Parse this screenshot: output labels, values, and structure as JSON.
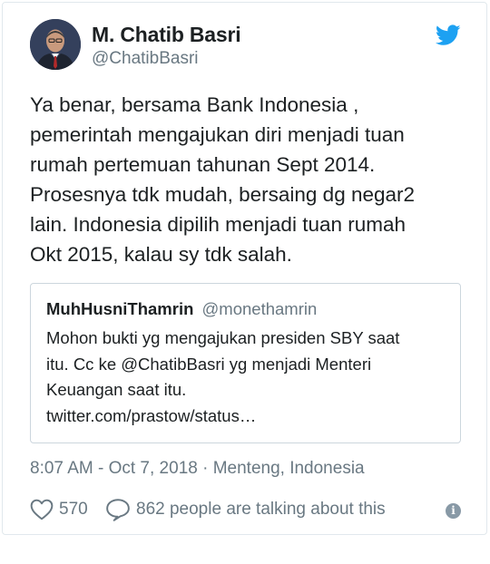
{
  "author": {
    "name": "M. Chatib Basri",
    "handle": "@ChatibBasri"
  },
  "tweet": {
    "text": "Ya benar, bersama Bank Indonesia ,\npemerintah mengajukan diri menjadi tuan\nrumah pertemuan tahunan Sept 2014.\nProsesnya tdk mudah, bersaing dg negar2\nlain. Indonesia dipilih menjadi tuan rumah\nOkt 2015, kalau sy tdk salah."
  },
  "quoted_tweet": {
    "name": "MuhHusniThamrin",
    "handle": "@monethamrin",
    "text": "Mohon bukti yg mengajukan presiden SBY saat\nitu. Cc ke @ChatibBasri yg menjadi Menteri\nKeuangan saat itu.\ntwitter.com/prastow/status…"
  },
  "meta": {
    "timestamp": "8:07 AM - Oct 7, 2018 · Menteng, Indonesia"
  },
  "actions": {
    "likes": "570",
    "talking": "862 people are talking about this"
  },
  "icons": {
    "brand": "twitter-bird-icon",
    "like": "heart-icon",
    "reply": "speech-bubble-icon",
    "info": "info-icon"
  },
  "colors": {
    "twitter_blue": "#1da1f2",
    "secondary_text": "#697882",
    "border": "#e1e8ed"
  }
}
